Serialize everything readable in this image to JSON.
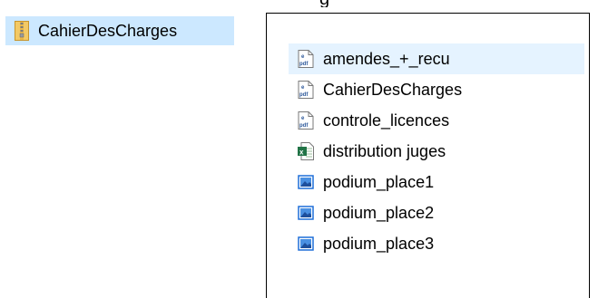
{
  "top_fragment": "g",
  "zip_item": {
    "label": "CahierDesCharges",
    "icon": "zip-folder-icon"
  },
  "file_list": [
    {
      "label": "amendes_+_recu",
      "icon": "pdf-file-icon",
      "selected": true
    },
    {
      "label": "CahierDesCharges",
      "icon": "pdf-file-icon",
      "selected": false
    },
    {
      "label": "controle_licences",
      "icon": "pdf-file-icon",
      "selected": false
    },
    {
      "label": "distribution juges",
      "icon": "excel-file-icon",
      "selected": false
    },
    {
      "label": "podium_place1",
      "icon": "image-file-icon",
      "selected": false
    },
    {
      "label": "podium_place2",
      "icon": "image-file-icon",
      "selected": false
    },
    {
      "label": "podium_place3",
      "icon": "image-file-icon",
      "selected": false
    }
  ],
  "colors": {
    "selection": "#cce8ff",
    "hover": "#e5f3ff",
    "pdf_accent": "#2b579a",
    "excel_accent": "#217346",
    "image_accent": "#1e6fd9",
    "zip_accent": "#e8b74a"
  }
}
